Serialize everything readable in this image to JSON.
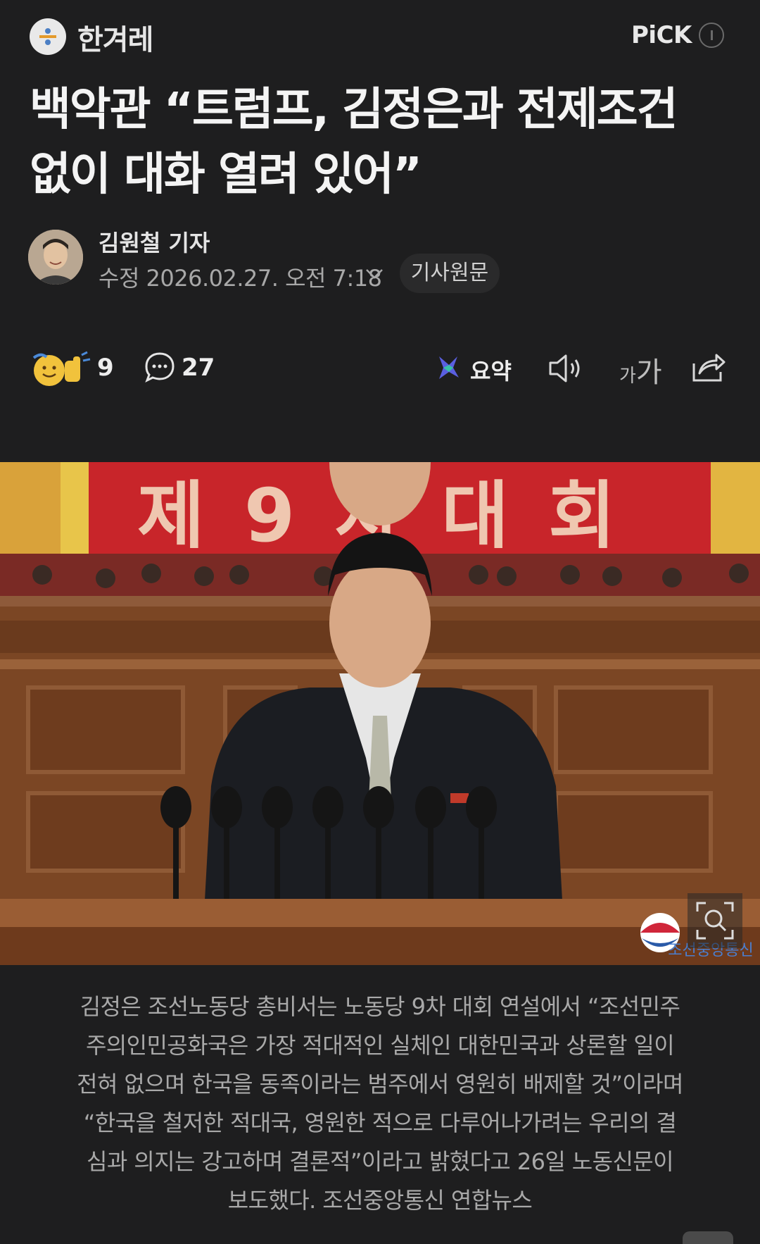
{
  "header": {
    "press_name": "한겨레",
    "pick_label": "PiCK"
  },
  "article": {
    "title_line1": "백악관 “트럼프, 김정은과 전제조건",
    "title_line2": "없이 대화 열려 있어”",
    "reporter": "김원철 기자",
    "datetime": "수정 2026.02.27. 오전 7:18",
    "original_button": "기사원문"
  },
  "actions": {
    "reaction_count": "9",
    "comment_count": "27",
    "summary_label": "요약",
    "font_small": "가",
    "font_large": "가"
  },
  "photo": {
    "banner_text": "제 9 차 대 회",
    "watermark": "조선중앙통신"
  },
  "caption": {
    "line1": "김정은 조선노동당 총비서는 노동당 9차 대회 연설에서 “조선민주",
    "line2": "주의인민공화국은 가장 적대적인 실체인 대한민국과 상론할 일이",
    "line3": "전혀 없으며 한국을 동족이라는 범주에서 영원히 배제할 것”이라며",
    "line4": "“한국을 철저한 적대국, 영원한 적으로 다루어나가려는 우리의 결",
    "line5": "심과 의지는 강고하며 결론적”이라고 밝혔다고 26일 노동신문이",
    "line6": "보도했다. 조선중앙통신 연합뉴스"
  },
  "colors": {
    "background": "#1e1e1f",
    "title_text": "#f4f4f4",
    "secondary_text": "#a8a8a8",
    "banner_red": "#c8252a"
  }
}
